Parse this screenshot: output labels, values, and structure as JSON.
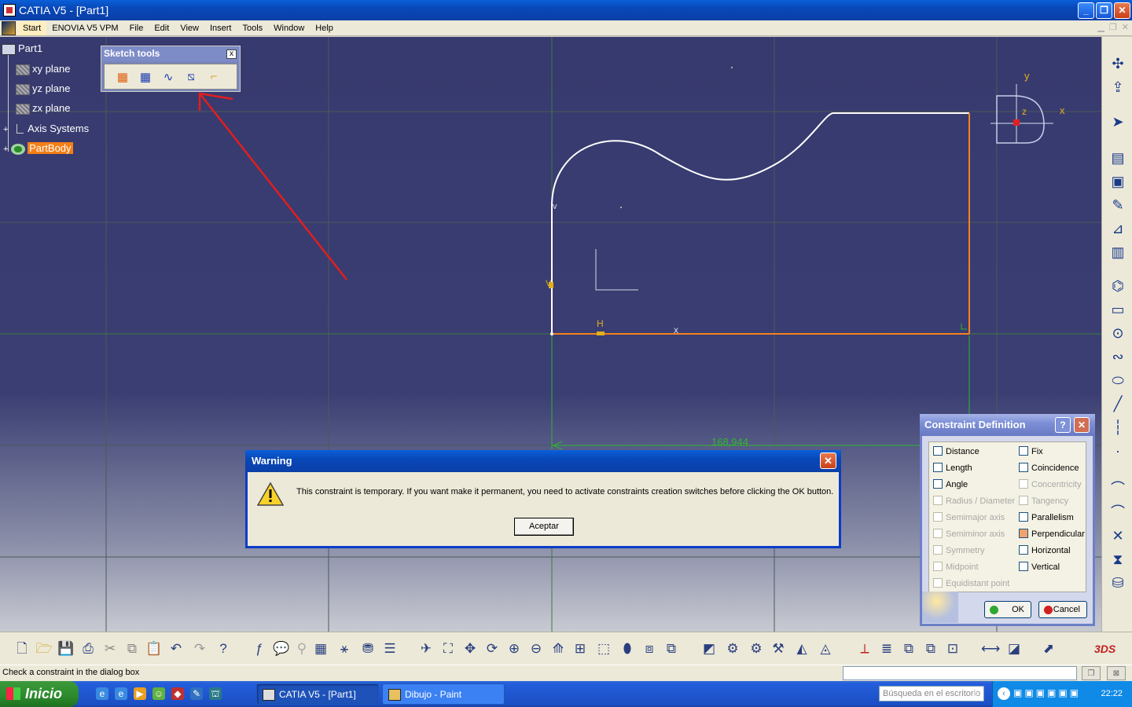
{
  "window": {
    "title": "CATIA V5 - [Part1]",
    "minimize": "_",
    "restore": "❐",
    "close": "✕"
  },
  "menu": {
    "items": [
      "Start",
      "ENOVIA V5 VPM",
      "File",
      "Edit",
      "View",
      "Insert",
      "Tools",
      "Window",
      "Help"
    ]
  },
  "tree": {
    "root": "Part1",
    "nodes": [
      "xy plane",
      "yz plane",
      "zx plane",
      "Axis Systems",
      "PartBody"
    ]
  },
  "sketch_tools": {
    "title": "Sketch tools",
    "close": "x"
  },
  "canvas": {
    "axis_y": "y",
    "axis_x": "x",
    "axis_z": "z",
    "dimension": "168,944",
    "label_h": "H",
    "label_v": "V",
    "label_x": "x",
    "label_v2": "v"
  },
  "warning": {
    "title": "Warning",
    "message": "This constraint is temporary. If you want make it permanent, you need to activate constraints creation switches before clicking the OK button.",
    "ok": "Aceptar",
    "close": "✕"
  },
  "constraint_definition": {
    "title": "Constraint Definition",
    "help": "?",
    "close": "✕",
    "left_column": [
      {
        "label": "Distance",
        "enabled": true,
        "checked": false
      },
      {
        "label": "Length",
        "enabled": true,
        "checked": false
      },
      {
        "label": "Angle",
        "enabled": true,
        "checked": false
      },
      {
        "label": "Radius / Diameter",
        "enabled": false,
        "checked": false
      },
      {
        "label": "Semimajor axis",
        "enabled": false,
        "checked": false
      },
      {
        "label": "Semiminor axis",
        "enabled": false,
        "checked": false
      },
      {
        "label": "Symmetry",
        "enabled": false,
        "checked": false
      },
      {
        "label": "Midpoint",
        "enabled": false,
        "checked": false
      },
      {
        "label": "Equidistant point",
        "enabled": false,
        "checked": false
      }
    ],
    "right_column": [
      {
        "label": "Fix",
        "enabled": true,
        "checked": false
      },
      {
        "label": "Coincidence",
        "enabled": true,
        "checked": false
      },
      {
        "label": "Concentricity",
        "enabled": false,
        "checked": false
      },
      {
        "label": "Tangency",
        "enabled": false,
        "checked": false
      },
      {
        "label": "Parallelism",
        "enabled": true,
        "checked": false
      },
      {
        "label": "Perpendicular",
        "enabled": true,
        "checked": true
      },
      {
        "label": "Horizontal",
        "enabled": true,
        "checked": false
      },
      {
        "label": "Vertical",
        "enabled": true,
        "checked": false
      }
    ],
    "ok": "OK",
    "cancel": "Cancel"
  },
  "status": {
    "text": "Check a constraint in the dialog box"
  },
  "taskbar": {
    "start": "Inicio",
    "tasks": [
      "CATIA V5 - [Part1]",
      "Dibujo - Paint"
    ],
    "search_placeholder": "Búsqueda en el escritorio",
    "clock": "22:22"
  },
  "colors": {
    "viewport": "#373a6e",
    "profile_white": "#ffffff",
    "profile_orange": "#f58220",
    "annotation_red": "#e21e1e",
    "dimension_green": "#2fb62f"
  }
}
